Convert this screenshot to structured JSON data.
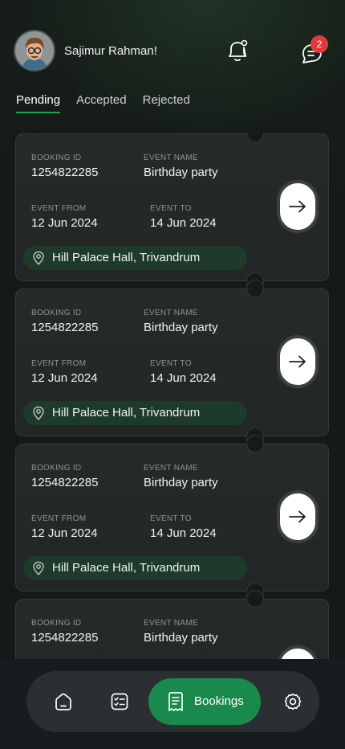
{
  "user": {
    "name": "Sajimur Rahman!"
  },
  "notifications": {
    "chat_badge_count": "2"
  },
  "tabs": [
    {
      "label": "Pending",
      "active": true
    },
    {
      "label": "Accepted",
      "active": false
    },
    {
      "label": "Rejected",
      "active": false
    }
  ],
  "bookings": [
    {
      "booking_id_label": "BOOKING ID",
      "booking_id": "1254822285",
      "event_name_label": "EVENT NAME",
      "event_name": "Birthday party",
      "event_from_label": "EVENT FROM",
      "event_from": "12 Jun 2024",
      "event_to_label": "EVENT TO",
      "event_to": "14 Jun 2024",
      "location": "Hill Palace Hall, Trivandrum"
    },
    {
      "booking_id_label": "BOOKING ID",
      "booking_id": "1254822285",
      "event_name_label": "EVENT NAME",
      "event_name": "Birthday party",
      "event_from_label": "EVENT FROM",
      "event_from": "12 Jun 2024",
      "event_to_label": "EVENT TO",
      "event_to": "14 Jun 2024",
      "location": "Hill Palace Hall, Trivandrum"
    },
    {
      "booking_id_label": "BOOKING ID",
      "booking_id": "1254822285",
      "event_name_label": "EVENT NAME",
      "event_name": "Birthday party",
      "event_from_label": "EVENT FROM",
      "event_from": "12 Jun 2024",
      "event_to_label": "EVENT TO",
      "event_to": "14 Jun 2024",
      "location": "Hill Palace Hall, Trivandrum"
    },
    {
      "booking_id_label": "BOOKING ID",
      "booking_id": "1254822285",
      "event_name_label": "EVENT NAME",
      "event_name": "Birthday party"
    }
  ],
  "bottom_nav": {
    "items": [
      {
        "icon": "home-icon"
      },
      {
        "icon": "checklist-icon"
      },
      {
        "icon": "receipt-icon",
        "label": "Bookings",
        "active": true
      },
      {
        "icon": "gear-icon"
      }
    ]
  },
  "colors": {
    "accent": "#1a8a4c",
    "badge": "#e03a3e",
    "location_pill": "#1e3a2b"
  }
}
